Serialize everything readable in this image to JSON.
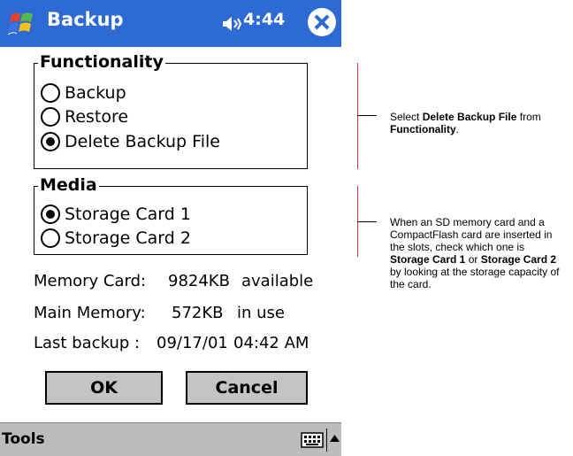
{
  "titlebar": {
    "title": "Backup",
    "time": "4:44"
  },
  "functionality": {
    "title": "Functionality",
    "options": [
      {
        "label": "Backup",
        "selected": false
      },
      {
        "label": "Restore",
        "selected": false
      },
      {
        "label": "Delete Backup File",
        "selected": true
      }
    ]
  },
  "media": {
    "title": "Media",
    "options": [
      {
        "label": "Storage Card 1",
        "selected": true
      },
      {
        "label": "Storage Card 2",
        "selected": false
      }
    ]
  },
  "info": {
    "memory_card": {
      "label": "Memory Card:",
      "value": "9824KB",
      "status": "available"
    },
    "main_memory": {
      "label": "Main Memory:",
      "value": "572KB",
      "status": "in use"
    },
    "last_backup": {
      "label": "Last backup :",
      "date": "09/17/01",
      "time": "04:42 AM"
    }
  },
  "buttons": {
    "ok": "OK",
    "cancel": "Cancel"
  },
  "menubar": {
    "tools": "Tools"
  },
  "callouts": {
    "first": {
      "t1": "Select ",
      "b1": "Delete Backup File",
      "t2": " from ",
      "b2": "Functionality",
      "t3": "."
    },
    "second": {
      "t1": "When an SD memory card and a CompactFlash card are inserted in the slots, check which one is ",
      "b1": "Storage Card 1",
      "t2": " or ",
      "b2": "Storage Card 2",
      "t3": " by looking at the storage capacity of the card."
    }
  },
  "colors": {
    "titlebar": "#2d6ad4",
    "menubar": "#bcbcbc",
    "button": "#c4c4c4",
    "callout_line": "#d23a3a"
  }
}
